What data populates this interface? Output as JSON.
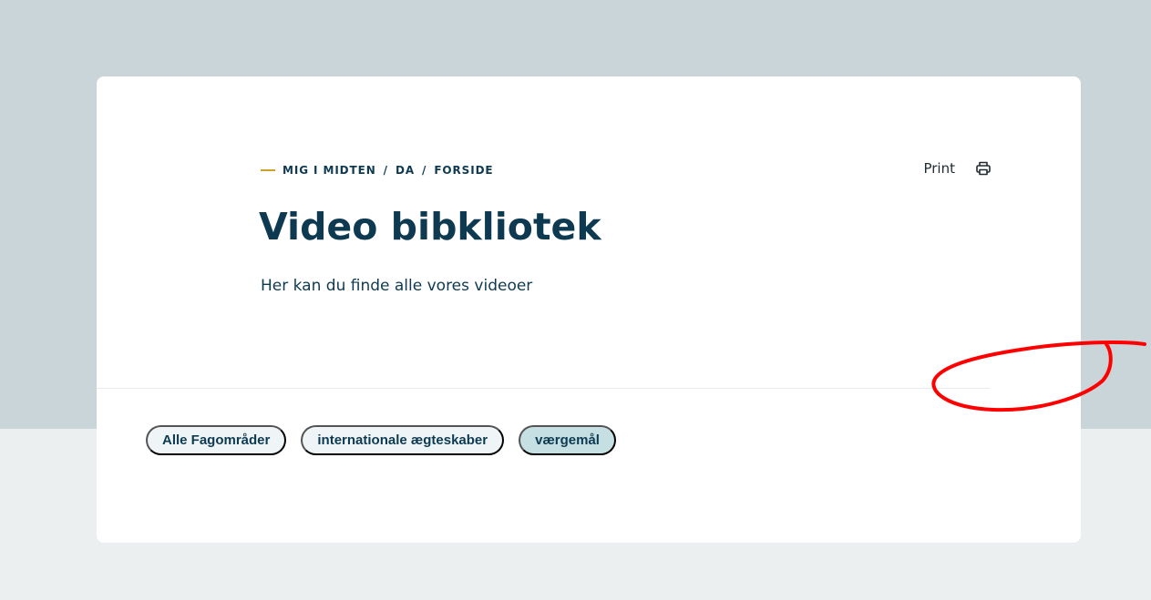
{
  "breadcrumb": {
    "items": [
      "MIG I MIDTEN",
      "DA",
      "FORSIDE"
    ],
    "separator": "/"
  },
  "print": {
    "label": "Print",
    "icon": "printer-icon"
  },
  "page": {
    "title": "Video bibkliotek",
    "lead": "Her kan du finde alle vores videoer"
  },
  "filters": {
    "chips": [
      "Alle Fagområder",
      "internationale ægteskaber",
      "værgemål"
    ],
    "active": "værgemål"
  },
  "colors": {
    "hero_background": "#c9d5d8",
    "page_background": "#eceff0",
    "card": "#ffffff",
    "text_primary": "#0e3a51",
    "breadcrumb_accent": "#c9a227",
    "chip_background": "#eff5f6",
    "chip_active_background": "#c5dfe3",
    "annotation": "#ff0000"
  }
}
